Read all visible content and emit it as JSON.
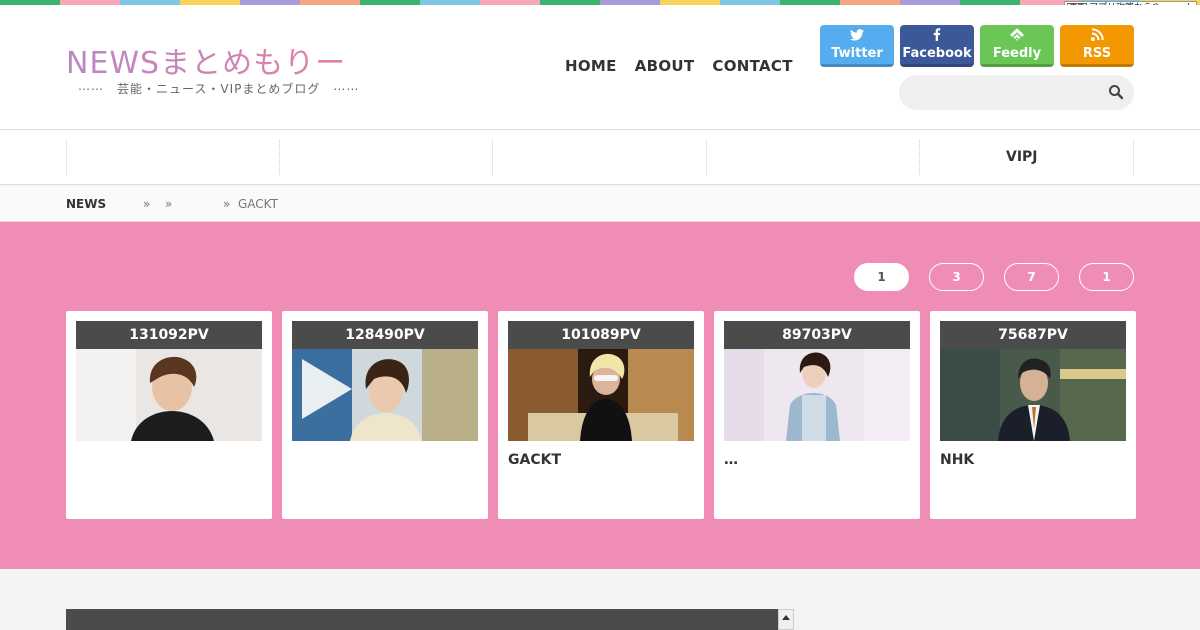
{
  "stripe_colors": [
    "#3cb371",
    "#f7a8b8",
    "#7ec8e3",
    "#f7d358",
    "#a89cd8",
    "#f4a582",
    "#3cb371",
    "#7ec8e3",
    "#f7a8b8",
    "#3cb371",
    "#a89cd8",
    "#f7d358",
    "#7ec8e3",
    "#3cb371",
    "#f4a582",
    "#a89cd8",
    "#3cb371",
    "#f7a8b8",
    "#7ec8e3",
    "#f7d358"
  ],
  "ad_badge": {
    "mark": "広告",
    "text": "アプリ攻略ならGamerch"
  },
  "header": {
    "logo": "NEWSまとめもりー",
    "tagline": "⋯⋯　芸能・ニュース・VIPまとめブログ　⋯⋯"
  },
  "nav": [
    {
      "label": "HOME"
    },
    {
      "label": "ABOUT"
    },
    {
      "label": "CONTACT"
    }
  ],
  "social": [
    {
      "label": "Twitter",
      "icon": "twitter-icon",
      "color": "#55acee"
    },
    {
      "label": "Facebook",
      "icon": "facebook-icon",
      "color": "#3b5998"
    },
    {
      "label": "Feedly",
      "icon": "feedly-icon",
      "color": "#6cc655"
    },
    {
      "label": "RSS",
      "icon": "rss-icon",
      "color": "#f39800"
    }
  ],
  "search": {
    "placeholder": ""
  },
  "categories": [
    {
      "label": ""
    },
    {
      "label": ""
    },
    {
      "label": ""
    },
    {
      "label": ""
    },
    {
      "label": "VIPJ"
    }
  ],
  "breadcrumb": {
    "home": "NEWS",
    "sep1": "»",
    "sep2": "»",
    "sep3": "»",
    "current": "GACKT"
  },
  "ranking_tabs": [
    {
      "label": "1",
      "active": true
    },
    {
      "label": "3",
      "active": false
    },
    {
      "label": "7",
      "active": false
    },
    {
      "label": "1",
      "active": false
    }
  ],
  "cards": [
    {
      "pv": "131092PV",
      "title": ""
    },
    {
      "pv": "128490PV",
      "title": ""
    },
    {
      "pv": "101089PV",
      "title": "GACKT"
    },
    {
      "pv": "89703PV",
      "title": "…"
    },
    {
      "pv": "75687PV",
      "title": "NHK"
    }
  ]
}
